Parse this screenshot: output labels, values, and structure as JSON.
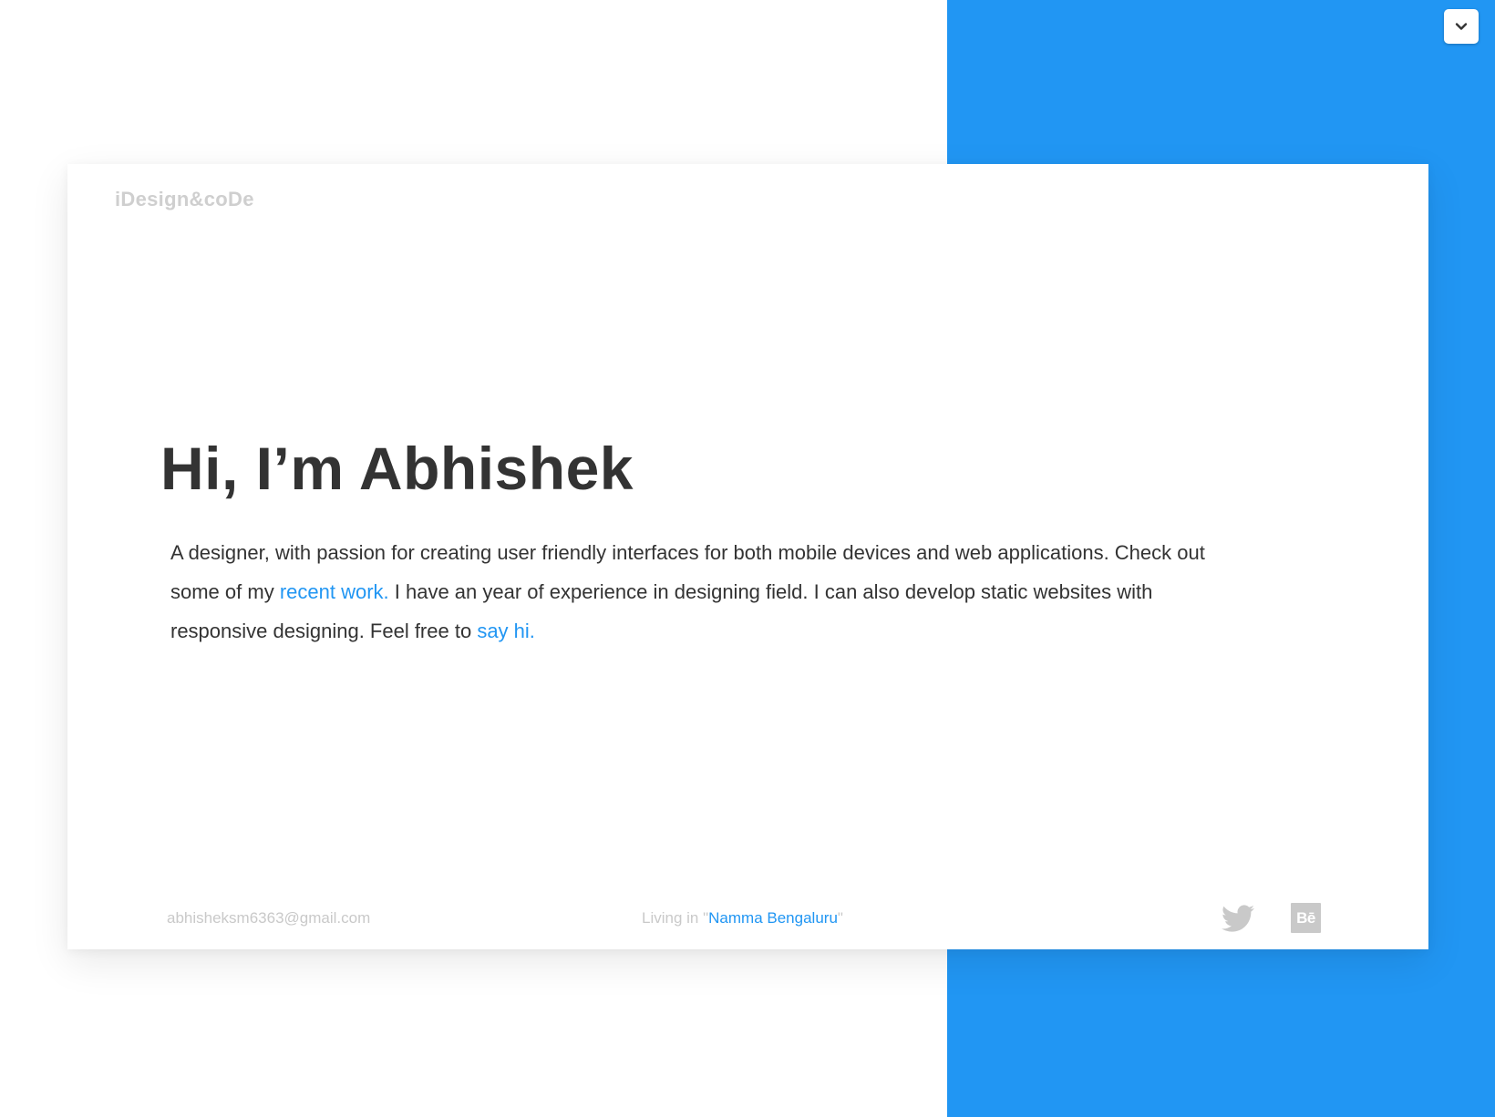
{
  "colors": {
    "accent": "#2196f3",
    "heading_text": "#333333",
    "muted_text": "#c9c9c9"
  },
  "header": {
    "logo": "iDesign&coDe",
    "menu_icon": "chevron-down-icon"
  },
  "hero": {
    "heading": "Hi, I’m Abhishek",
    "intro_part1": "A designer, with passion for creating user friendly interfaces for both mobile devices and web applications. Check out some of my ",
    "recent_work_link": "recent work.",
    "intro_part2": " I have an year of experience in designing field. I can also develop static websites with responsive designing. Feel free to ",
    "say_hi_link": "say hi."
  },
  "footer": {
    "email": "abhisheksm6363@gmail.com",
    "location_prefix": "Living in ",
    "location_open_quote": "\"",
    "location_city": "Namma Bengaluru",
    "location_close_quote": "\"",
    "social": [
      {
        "name": "twitter",
        "icon": "twitter-icon"
      },
      {
        "name": "behance",
        "icon": "behance-icon",
        "label": "Bē"
      }
    ]
  }
}
